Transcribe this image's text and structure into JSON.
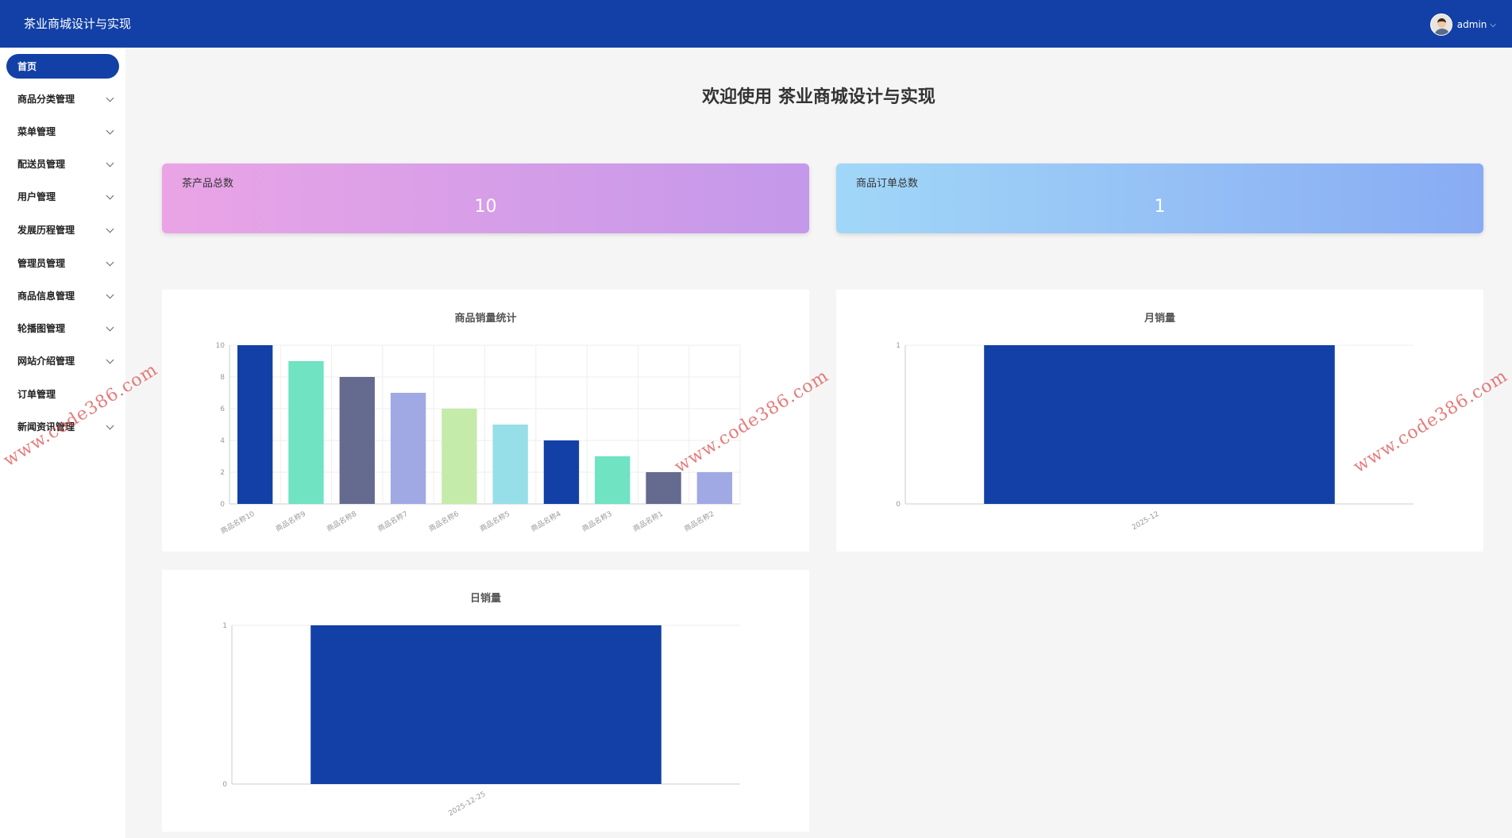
{
  "app": {
    "title": "茶业商城设计与实现"
  },
  "user": {
    "name": "admin"
  },
  "sidebar": {
    "items": [
      {
        "label": "首页",
        "active": true,
        "has_children": false
      },
      {
        "label": "商品分类管理",
        "has_children": true
      },
      {
        "label": "菜单管理",
        "has_children": true
      },
      {
        "label": "配送员管理",
        "has_children": true
      },
      {
        "label": "用户管理",
        "has_children": true
      },
      {
        "label": "发展历程管理",
        "has_children": true
      },
      {
        "label": "管理员管理",
        "has_children": true
      },
      {
        "label": "商品信息管理",
        "has_children": true
      },
      {
        "label": "轮播图管理",
        "has_children": true
      },
      {
        "label": "网站介绍管理",
        "has_children": true
      },
      {
        "label": "订单管理",
        "has_children": false
      },
      {
        "label": "新闻资讯管理",
        "has_children": true
      }
    ]
  },
  "main": {
    "welcome": "欢迎使用 茶业商城设计与实现"
  },
  "stats": [
    {
      "label": "茶产品总数",
      "value": "10"
    },
    {
      "label": "商品订单总数",
      "value": "1"
    }
  ],
  "watermark": "www.code386.com",
  "colors": {
    "primary": "#1240a6",
    "palette": [
      "#1240a6",
      "#6fe3c2",
      "#646b8f",
      "#a0a9e4",
      "#c5ebaa",
      "#96dfe8"
    ]
  },
  "chart_data": [
    {
      "type": "bar",
      "title": "商品销量统计",
      "categories": [
        "商品名称10",
        "商品名称9",
        "商品名称8",
        "商品名称7",
        "商品名称6",
        "商品名称5",
        "商品名称4",
        "商品名称3",
        "商品名称1",
        "商品名称2"
      ],
      "values": [
        10,
        9,
        8,
        7,
        6,
        5,
        4,
        3,
        2,
        2
      ],
      "yticks": [
        0,
        2,
        4,
        6,
        8,
        10
      ],
      "ylim": [
        0,
        10
      ],
      "grid": true
    },
    {
      "type": "bar",
      "title": "月销量",
      "categories": [
        "2025-12"
      ],
      "values": [
        1
      ],
      "yticks": [
        0,
        1
      ],
      "ylim": [
        0,
        1
      ]
    },
    {
      "type": "bar",
      "title": "日销量",
      "categories": [
        "2025-12-25"
      ],
      "values": [
        1
      ],
      "yticks": [
        0,
        1
      ],
      "ylim": [
        0,
        1
      ]
    }
  ]
}
